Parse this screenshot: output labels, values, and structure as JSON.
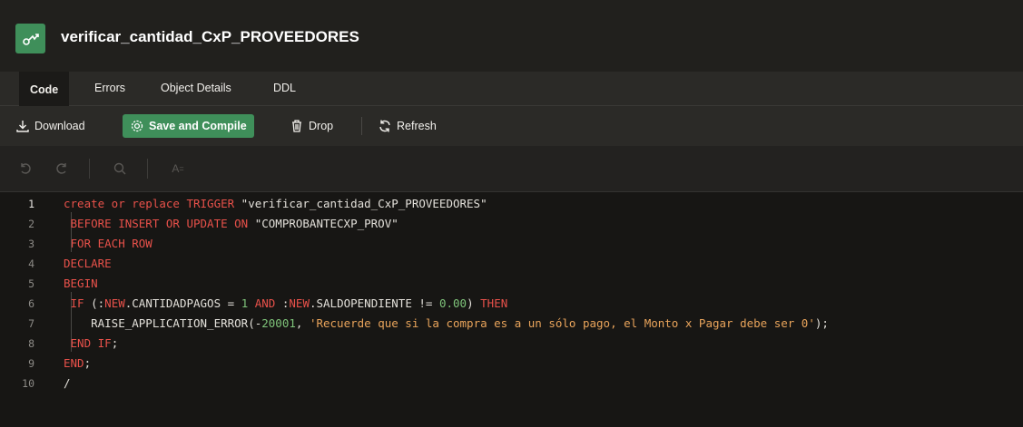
{
  "title": "verificar_cantidad_CxP_PROVEEDORES",
  "tabs": [
    {
      "label": "Code",
      "active": true
    },
    {
      "label": "Errors",
      "active": false
    },
    {
      "label": "Object Details",
      "active": false
    },
    {
      "label": "DDL",
      "active": false
    }
  ],
  "toolbar": {
    "download": "Download",
    "save_compile": "Save and Compile",
    "drop": "Drop",
    "refresh": "Refresh"
  },
  "editor_tools": {
    "undo_icon": "undo-icon",
    "redo_icon": "redo-icon",
    "search_icon": "search-icon",
    "font_icon": "text-size-icon",
    "font_glyph": "A"
  },
  "code_lines": [
    {
      "n": "1",
      "tokens": [
        [
          "kw",
          "create or replace TRIGGER "
        ],
        [
          "str",
          "\"verificar_cantidad_CxP_PROVEEDORES\""
        ]
      ]
    },
    {
      "n": "2",
      "tokens": [
        [
          "kw",
          " BEFORE INSERT OR UPDATE ON "
        ],
        [
          "str",
          "\"COMPROBANTECXP_PROV\""
        ]
      ]
    },
    {
      "n": "3",
      "tokens": [
        [
          "kw",
          " FOR EACH ROW"
        ]
      ]
    },
    {
      "n": "4",
      "tokens": [
        [
          "kw",
          "DECLARE"
        ]
      ]
    },
    {
      "n": "5",
      "tokens": [
        [
          "kw",
          "BEGIN"
        ]
      ]
    },
    {
      "n": "6",
      "tokens": [
        [
          "kw",
          " IF "
        ],
        [
          "str",
          "(:"
        ],
        [
          "kw",
          "NEW"
        ],
        [
          "str",
          ".CANTIDADPAGOS = "
        ],
        [
          "num",
          "1"
        ],
        [
          "kw",
          " AND "
        ],
        [
          "str",
          ":"
        ],
        [
          "kw",
          "NEW"
        ],
        [
          "str",
          ".SALDOPENDIENTE != "
        ],
        [
          "num",
          "0.00"
        ],
        [
          "str",
          ") "
        ],
        [
          "kw",
          "THEN"
        ]
      ]
    },
    {
      "n": "7",
      "tokens": [
        [
          "str",
          "    RAISE_APPLICATION_ERROR(-"
        ],
        [
          "num",
          "20001"
        ],
        [
          "str",
          ", "
        ],
        [
          "strlit",
          "'Recuerde que si la compra es a un sólo pago, el Monto x Pagar debe ser 0'"
        ],
        [
          "str",
          ");"
        ]
      ]
    },
    {
      "n": "8",
      "tokens": [
        [
          "kw",
          " END IF"
        ],
        [
          "str",
          ";"
        ]
      ]
    },
    {
      "n": "9",
      "tokens": [
        [
          "kw",
          "END"
        ],
        [
          "str",
          ";"
        ]
      ]
    },
    {
      "n": "10",
      "tokens": [
        [
          "str",
          "/"
        ]
      ]
    }
  ],
  "colors": {
    "accent": "#3f8f5a",
    "keyword": "#e8514a",
    "string_literal": "#e9a45b",
    "number": "#7fc47a"
  }
}
